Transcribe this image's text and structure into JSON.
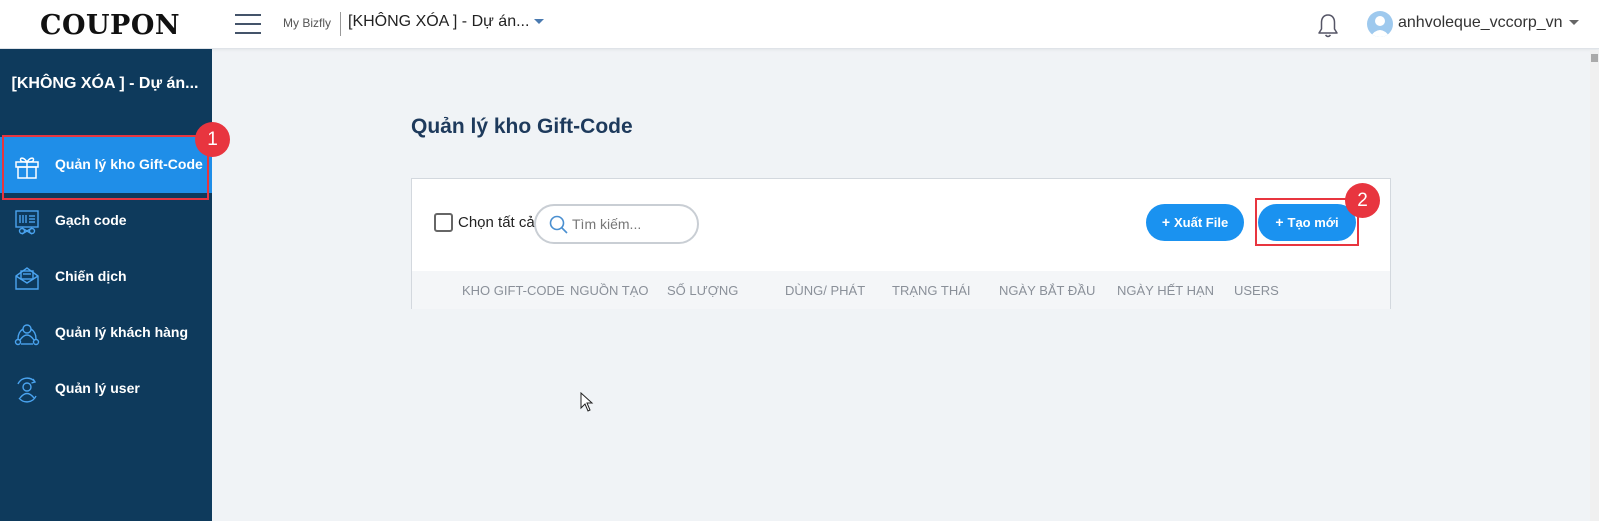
{
  "header": {
    "logo": "COUPON",
    "bizfly_label": "My Bizfly",
    "project_select": "[KHÔNG XÓA ] - Dự án...",
    "user_name": "anhvoleque_vccorp_vn"
  },
  "sidebar": {
    "title": "[KHÔNG XÓA ] - Dự án...",
    "items": [
      {
        "label": "Quản lý kho Gift-Code",
        "icon": "gift-icon"
      },
      {
        "label": "Gạch code",
        "icon": "code-scan-icon"
      },
      {
        "label": "Chiến dịch",
        "icon": "campaign-icon"
      },
      {
        "label": "Quản lý khách hàng",
        "icon": "customers-icon"
      },
      {
        "label": "Quản lý user",
        "icon": "user-manage-icon"
      }
    ],
    "active_index": 0
  },
  "annotations": {
    "badge_1": "1",
    "badge_2": "2",
    "color": "#e8353f"
  },
  "main": {
    "page_title": "Quản lý kho Gift-Code",
    "select_all_label": "Chọn tất cả",
    "search_placeholder": "Tìm kiếm...",
    "export_button": "Xuất File",
    "create_button": "Tạo mới",
    "table_columns": [
      "KHO GIFT-CODE",
      "NGUỒN TẠO",
      "SỐ LƯỢNG",
      "DÙNG/ PHÁT",
      "TRẠNG THÁI",
      "NGÀY BẮT ĐẦU",
      "NGÀY HẾT HẠN",
      "USERS"
    ]
  },
  "colors": {
    "sidebar_bg": "#0e3a5c",
    "sidebar_active": "#1f8ee8",
    "primary_button": "#1a92f0",
    "page_bg": "#f0f3f6"
  }
}
